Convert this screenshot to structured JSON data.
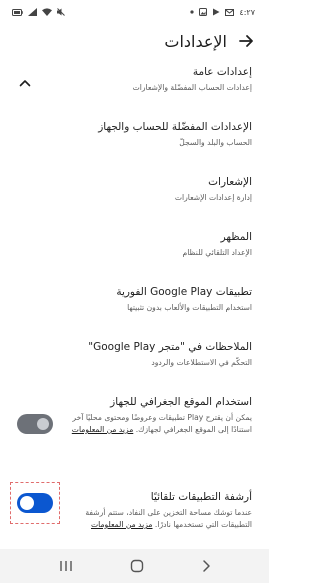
{
  "status_bar": {
    "time": "٤:٢٧"
  },
  "app_bar": {
    "title": "الإعدادات",
    "back_icon": "arrow-back-icon"
  },
  "sections": {
    "general_collapse_icon": "chevron-up-icon"
  },
  "items": [
    {
      "id": "general",
      "title": "إعدادات عامة",
      "subtitle": "إعدادات الحساب المفضّلة والإشعارات"
    },
    {
      "id": "account",
      "title": "الإعدادات المفضّلة للحساب والجهاز",
      "subtitle": "الحساب والبلد والسجلّ"
    },
    {
      "id": "notifications",
      "title": "الإشعارات",
      "subtitle": "إدارة إعدادات الإشعارات"
    },
    {
      "id": "appearance",
      "title": "المظهر",
      "subtitle": "الإعداد التلقائي للنظام"
    },
    {
      "id": "instant",
      "title": "تطبيقات Google Play الفورية",
      "subtitle": "استخدام التطبيقات والألعاب بدون تثبيتها"
    },
    {
      "id": "feedback",
      "title": "الملاحظات في \"متجر Google Play\"",
      "subtitle": "التحكّم في الاستطلاعات والردود"
    },
    {
      "id": "location",
      "title": "استخدام الموقع الجغرافي للجهاز",
      "subtitle": "يمكن أن يقترح Play تطبيقات وعروضًا ومحتوى محليًا آخر استنادًا إلى الموقع الجغرافي لجهازك.",
      "link": "مزيد من المعلومات",
      "toggle_on": false
    },
    {
      "id": "auto_archive",
      "title": "أرشفة التطبيقات تلقائيًا",
      "subtitle": "عندما توشك مساحة التخزين على النفاد، ستتم أرشفة التطبيقات التي تستخدمها نادرًا.",
      "link": "مزيد من المعلومات",
      "toggle_on": true
    }
  ],
  "colors": {
    "accent": "#0b57d0",
    "toggle_off": "#6d7178"
  }
}
